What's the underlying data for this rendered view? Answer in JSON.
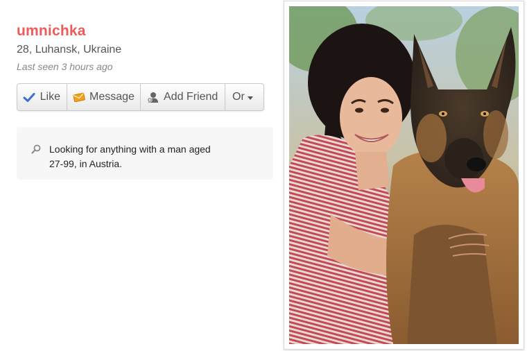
{
  "profile": {
    "username": "umnichka",
    "details": "28, Luhansk, Ukraine",
    "last_seen": "Last seen 3 hours ago"
  },
  "actions": {
    "like_label": "Like",
    "message_label": "Message",
    "add_friend_label": "Add Friend",
    "or_label": "Or"
  },
  "looking_for": {
    "text": "Looking for anything with a man aged 27-99, in Austria."
  },
  "colors": {
    "username": "#ef5b5b",
    "like_check": "#3b6fd1",
    "message_envelope": "#f2a21a"
  },
  "icons": {
    "like": "check-icon",
    "message": "envelope-icon",
    "add_friend": "person-add-icon",
    "looking_for": "search-icon",
    "or": "caret-down-icon"
  }
}
